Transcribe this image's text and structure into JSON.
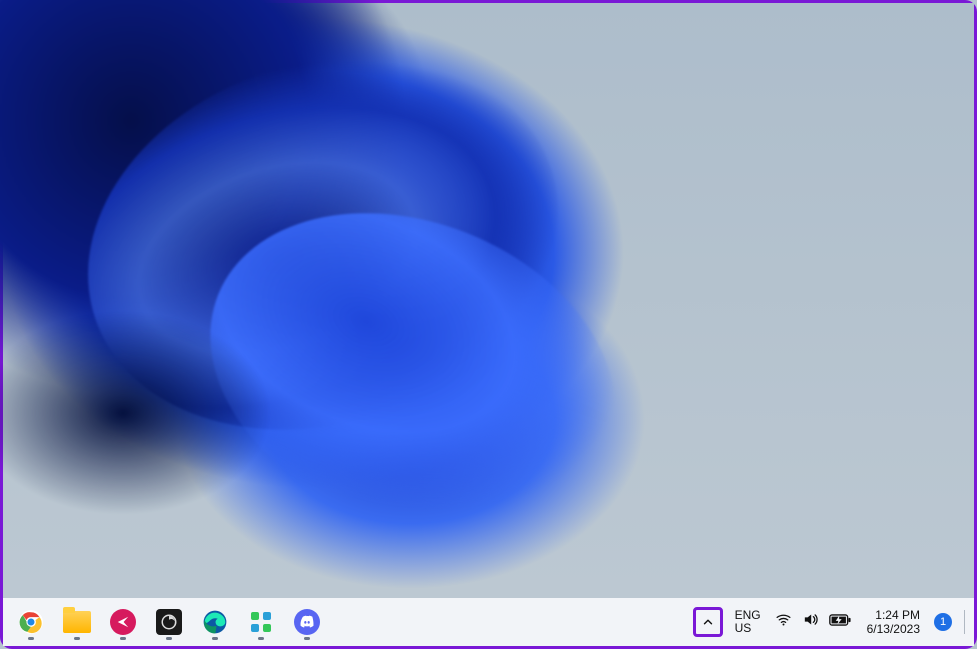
{
  "taskbar": {
    "apps": [
      {
        "name": "chrome",
        "label": "Google Chrome",
        "running": true
      },
      {
        "name": "file-explorer",
        "label": "File Explorer",
        "running": true
      },
      {
        "name": "screenpresso",
        "label": "Screenpresso",
        "running": true
      },
      {
        "name": "obs",
        "label": "OBS Studio",
        "running": true
      },
      {
        "name": "edge",
        "label": "Microsoft Edge",
        "running": true
      },
      {
        "name": "app-green",
        "label": "App",
        "running": true
      },
      {
        "name": "discord",
        "label": "Discord",
        "running": true
      }
    ],
    "overflow_tooltip": "Show hidden icons",
    "language": {
      "line1": "ENG",
      "line2": "US"
    },
    "clock": {
      "time": "1:24 PM",
      "date": "6/13/2023"
    },
    "notification_count": "1"
  },
  "colors": {
    "highlight": "#7a18d6",
    "accent": "#1f6fe5"
  }
}
